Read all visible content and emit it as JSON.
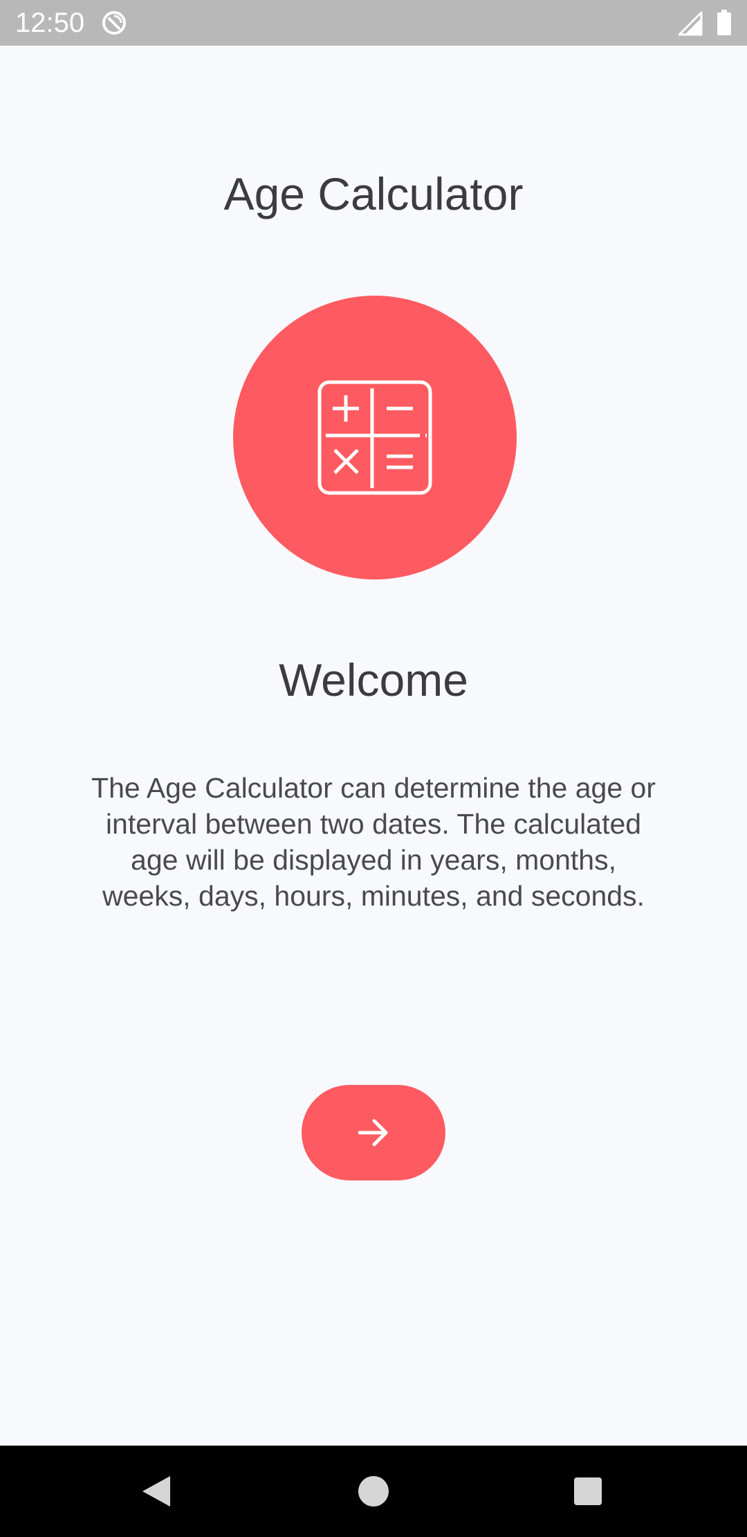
{
  "status_bar": {
    "time": "12:50",
    "icons": [
      "sync-icon",
      "signal-icon",
      "battery-icon"
    ]
  },
  "app": {
    "title": "Age Calculator",
    "hero_icon": "calculator-icon",
    "welcome_title": "Welcome",
    "description": "The Age Calculator can determine the age or interval between two dates. The calculated age will be displayed in years, months, weeks, days, hours, minutes, and seconds.",
    "next_button_icon": "arrow-right-icon"
  },
  "nav_bar": {
    "icons": [
      "back-icon",
      "home-icon",
      "recents-icon"
    ]
  },
  "colors": {
    "accent": "#fd5b61",
    "background": "#f8f9fd",
    "status_bar": "#b8b8b9",
    "text": "#3c3c3f",
    "nav_bar": "#000000"
  }
}
